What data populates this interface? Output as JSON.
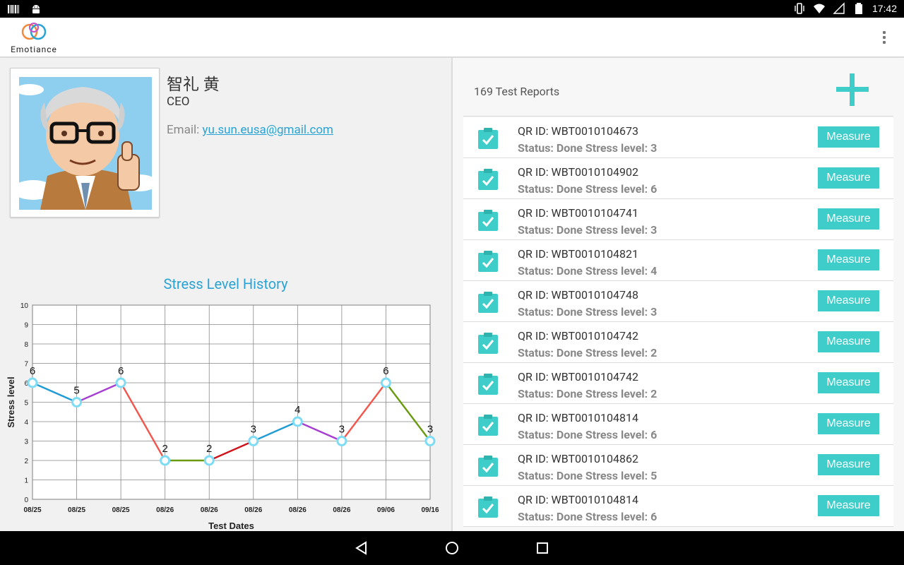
{
  "status_bar": {
    "time": "17:42",
    "icons": [
      "barcode-icon",
      "android-icon",
      "vibrate-icon",
      "wifi-icon",
      "signal-off-icon",
      "battery-icon"
    ]
  },
  "app_bar": {
    "logo_text": "Emotiance",
    "menu_icon": "overflow-menu-icon"
  },
  "profile": {
    "name": "智礼 黄",
    "title": "CEO",
    "email_label": "Email: ",
    "email": "yu.sun.eusa@gmail.com"
  },
  "reports": {
    "count_label": "169 Test Reports",
    "add_icon": "plus-icon",
    "measure_label": "Measure",
    "items": [
      {
        "qr_id": "QR ID: WBT0010104673",
        "status": "Status: Done  Stress level: 3"
      },
      {
        "qr_id": "QR ID: WBT0010104902",
        "status": "Status: Done  Stress level: 6"
      },
      {
        "qr_id": "QR ID: WBT0010104741",
        "status": "Status: Done  Stress level: 3"
      },
      {
        "qr_id": "QR ID: WBT0010104821",
        "status": "Status: Done  Stress level: 4"
      },
      {
        "qr_id": "QR ID: WBT0010104748",
        "status": "Status: Done  Stress level: 3"
      },
      {
        "qr_id": "QR ID: WBT0010104742",
        "status": "Status: Done  Stress level: 2"
      },
      {
        "qr_id": "QR ID: WBT0010104742",
        "status": "Status: Done  Stress level: 2"
      },
      {
        "qr_id": "QR ID: WBT0010104814",
        "status": "Status: Done  Stress level: 6"
      },
      {
        "qr_id": "QR ID: WBT0010104862",
        "status": "Status: Done  Stress level: 5"
      },
      {
        "qr_id": "QR ID: WBT0010104814",
        "status": "Status: Done  Stress level: 6"
      }
    ]
  },
  "chart_data": {
    "type": "line",
    "title": "Stress Level History",
    "xlabel": "Test Dates",
    "ylabel": "Stress level",
    "categories": [
      "08/25",
      "08/25",
      "08/25",
      "08/26",
      "08/26",
      "08/26",
      "08/26",
      "08/26",
      "09/06",
      "09/16"
    ],
    "values": [
      6,
      5,
      6,
      2,
      2,
      3,
      4,
      3,
      6,
      3
    ],
    "segment_colors": [
      "#1f9bd6",
      "#a63fd1",
      "#f2554b",
      "#6a9a10",
      "#d0121a",
      "#1f9bd6",
      "#a63fd1",
      "#f2554b",
      "#6a9a10"
    ],
    "ylim": [
      0,
      10
    ],
    "yticks": [
      0,
      1,
      2,
      3,
      4,
      5,
      6,
      7,
      8,
      9,
      10
    ],
    "grid": true,
    "marker_color": "#7fdcf5"
  },
  "nav_bar": {
    "icons": [
      "back-icon",
      "home-icon",
      "recents-icon"
    ]
  }
}
